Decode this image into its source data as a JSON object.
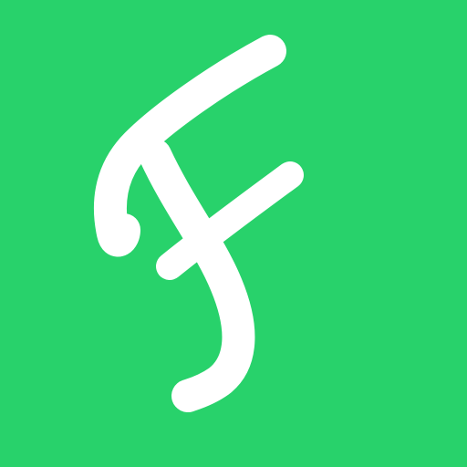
{
  "icon": {
    "name": "script-f-logo-icon",
    "background_color": "#28d26b",
    "glyph_color": "#ffffff"
  }
}
